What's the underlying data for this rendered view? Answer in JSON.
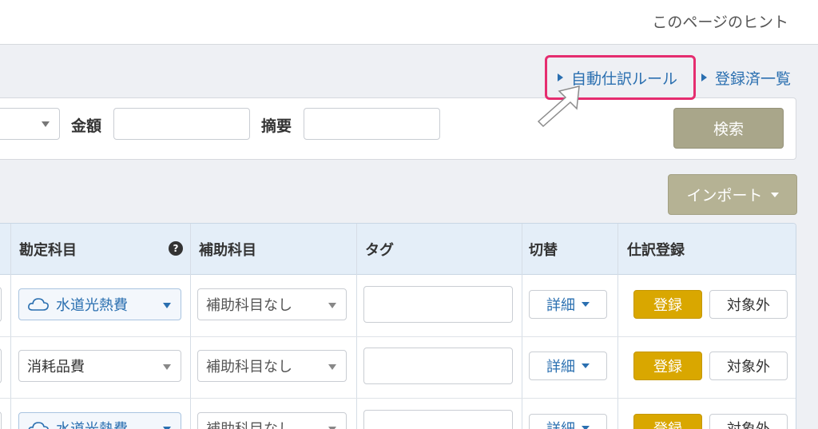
{
  "header": {
    "hint": "このページのヒント"
  },
  "links": {
    "auto_rule": "自動仕訳ルール",
    "registered_list": "登録済一覧"
  },
  "search": {
    "amount_label": "金額",
    "memo_label": "摘要",
    "amount_value": "",
    "memo_value": "",
    "search_button": "検索"
  },
  "toolbar": {
    "import_button": "インポート"
  },
  "table": {
    "headers": [
      "勘定科目",
      "補助科目",
      "タグ",
      "切替",
      "仕訳登録"
    ],
    "rows": [
      {
        "account": "水道光熱費",
        "account_style": "cloud",
        "sub_account": "補助科目なし",
        "tag": "",
        "toggle": "詳細",
        "register": "登録",
        "exclude": "対象外"
      },
      {
        "account": "消耗品費",
        "account_style": "plain",
        "sub_account": "補助科目なし",
        "tag": "",
        "toggle": "詳細",
        "register": "登録",
        "exclude": "対象外"
      },
      {
        "account": "水道光熱費",
        "account_style": "cloud",
        "sub_account": "補助科目なし",
        "tag": "",
        "toggle": "詳細",
        "register": "登録",
        "exclude": "対象外"
      }
    ]
  },
  "colors": {
    "link": "#2a6fb0",
    "highlight": "#e52d6f",
    "register": "#d9a700",
    "search_button": "#a9a68a",
    "table_header": "#e4eef8"
  },
  "icons": {
    "help": "question-circle-icon",
    "cloud": "cloud-icon",
    "dropdown": "caret-down-icon",
    "link_marker": "triangle-right-icon",
    "pointer": "arrow-pointer-icon"
  }
}
